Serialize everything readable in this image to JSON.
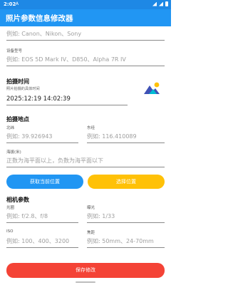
{
  "status_bar": {
    "time": "2:02",
    "notification_glyph": "A"
  },
  "app_bar": {
    "title": "照片参数信息修改器"
  },
  "camera_info": {
    "brand_placeholder": "例如: Canon、Nikon、Sony",
    "model_label": "设备型号",
    "model_placeholder": "例如: EOS 5D Mark IV、D850、Alpha 7R IV"
  },
  "capture_time": {
    "title": "拍摄时间",
    "hint": "照片拍摄的具体时间",
    "value": "2025:12:19 14:02:39",
    "icon": "image-icon"
  },
  "location": {
    "title": "拍摄地点",
    "latitude_label": "北纬",
    "latitude_placeholder": "例如: 39.926943",
    "longitude_label": "东经",
    "longitude_placeholder": "例如: 116.410089",
    "altitude_label": "海拔(米)",
    "altitude_placeholder": "正数为海平面以上，负数为海平面以下",
    "get_location_button": "获取当前位置",
    "choose_location_button": "选择位置"
  },
  "camera_params": {
    "title": "相机参数",
    "aperture_label": "光圈",
    "aperture_placeholder": "例如: f/2.8、f/8",
    "exposure_label": "曝光",
    "exposure_placeholder": "例如: 1/33",
    "iso_label": "ISO",
    "iso_placeholder": "例如: 100、400、3200",
    "focal_label": "焦距",
    "focal_placeholder": "例如: 50mm、24-70mm"
  },
  "save_button": "保存修改",
  "colors": {
    "primary": "#2196f3",
    "status_bar": "#1e88e5",
    "accent_yellow": "#ffc107",
    "save_red": "#f44336"
  }
}
